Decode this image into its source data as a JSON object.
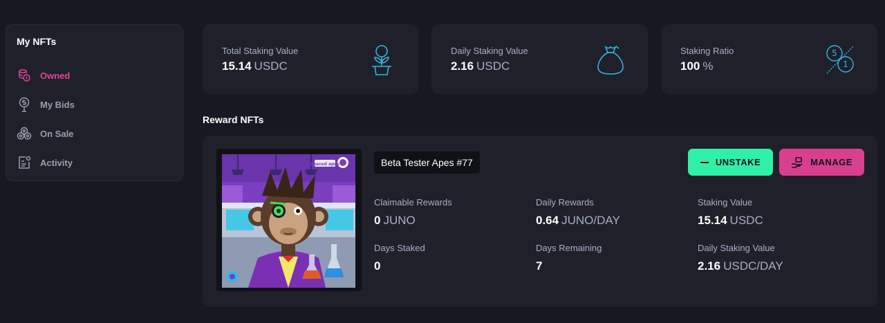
{
  "sidebar": {
    "title": "My NFTs",
    "items": [
      {
        "label": "Owned",
        "icon": "coins-icon",
        "active": true
      },
      {
        "label": "My Bids",
        "icon": "bid-icon"
      },
      {
        "label": "On Sale",
        "icon": "on-sale-icon"
      },
      {
        "label": "Activity",
        "icon": "activity-icon"
      }
    ]
  },
  "stats": [
    {
      "label": "Total Staking Value",
      "value": "15.14",
      "unit": "USDC",
      "icon": "plant-icon"
    },
    {
      "label": "Daily Staking Value",
      "value": "2.16",
      "unit": "USDC",
      "icon": "money-bag-icon"
    },
    {
      "label": "Staking Ratio",
      "value": "100",
      "unit": "%",
      "icon": "ratio-icon",
      "ratio_top": "5",
      "ratio_bottom": "1"
    }
  ],
  "section_title": "Reward NFTs",
  "nft": {
    "name": "Beta Tester Apes #77",
    "image_brand": "spaced apes",
    "unstake_label": "UNSTAKE",
    "manage_label": "MANAGE",
    "claimable_rewards": {
      "label": "Claimable Rewards",
      "value": "0",
      "unit": "JUNO"
    },
    "daily_rewards": {
      "label": "Daily Rewards",
      "value": "0.64",
      "unit": "JUNO/DAY"
    },
    "staking_value": {
      "label": "Staking Value",
      "value": "15.14",
      "unit": "USDC"
    },
    "days_staked": {
      "label": "Days Staked",
      "value": "0"
    },
    "days_remaining": {
      "label": "Days Remaining",
      "value": "7"
    },
    "daily_staking_value": {
      "label": "Daily Staking Value",
      "value": "2.16",
      "unit": "USDC/DAY"
    }
  },
  "colors": {
    "background": "#171821",
    "card": "#1f2029",
    "accent_pink": "#e0459a",
    "accent_green": "#2ff0a8",
    "icon_cyan": "#2fb8e6"
  }
}
